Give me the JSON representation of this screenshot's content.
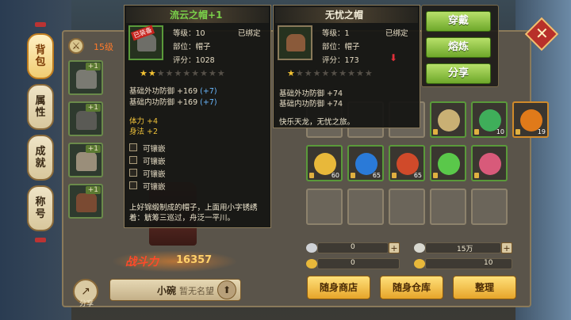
{
  "tabs": [
    "背包",
    "属性",
    "成就",
    "称号"
  ],
  "left_header": {
    "level": "15级"
  },
  "equip_slots": [
    {
      "plus": "+1",
      "icon": "helmet-icon"
    },
    {
      "plus": "+1",
      "icon": "armor-icon"
    },
    {
      "plus": "+1",
      "icon": "shoulder-icon"
    },
    {
      "plus": "+1",
      "icon": "boots-icon"
    }
  ],
  "character": {
    "power_label": "战斗力",
    "power_value": "16357",
    "name": "小碗",
    "title": "暂无名望",
    "share_label": "分享"
  },
  "tooltip_current": {
    "title": "流云之帽",
    "title_plus": "+1",
    "badge": "已装备",
    "level": "等级：10",
    "bound": "已绑定",
    "part": "部位：帽子",
    "score": "评分：1028",
    "stars_on": 2,
    "stars_total": 10,
    "stat1": "基础外功防御 +169",
    "stat1_bonus": "(+7)",
    "stat2": "基础内功防御 +169",
    "stat2_bonus": "(+7)",
    "attr1": "体力 +4",
    "attr2": "身法 +2",
    "sockets": [
      "可镶嵌",
      "可镶嵌",
      "可镶嵌",
      "可镶嵌"
    ],
    "desc": "上好锦缎制成的帽子，上面用小字锈绣着：觥筹三巡过，舟泛一平川。"
  },
  "tooltip_compare": {
    "title": "无忧之帽",
    "level": "等级：1",
    "bound": "已绑定",
    "part": "部位：帽子",
    "score": "评分：173",
    "stars_on": 1,
    "stars_total": 10,
    "stat1": "基础外功防御 +74",
    "stat2": "基础内功防御 +74",
    "desc": "快乐天龙，无忧之旅。"
  },
  "actions": [
    "穿戴",
    "熔炼",
    "分享"
  ],
  "inventory": [
    {
      "row": 0,
      "col": 0,
      "type": "empty"
    },
    {
      "row": 0,
      "col": 1,
      "type": "empty"
    },
    {
      "row": 0,
      "col": 2,
      "type": "empty"
    },
    {
      "row": 0,
      "col": 3,
      "type": "green",
      "item": "bracelet-icon",
      "count": ""
    },
    {
      "row": 0,
      "col": 4,
      "type": "green",
      "item": "necklace-icon",
      "count": "10"
    },
    {
      "row": 0,
      "col": 5,
      "type": "orange",
      "item": "scroll-icon",
      "count": "19"
    },
    {
      "row": 1,
      "col": 0,
      "type": "green",
      "item": "gold-ingot-icon",
      "count": "60"
    },
    {
      "row": 1,
      "col": 1,
      "type": "green",
      "item": "blue-sand-icon",
      "count": "65"
    },
    {
      "row": 1,
      "col": 2,
      "type": "green",
      "item": "red-sand-icon",
      "count": "65"
    },
    {
      "row": 1,
      "col": 3,
      "type": "green",
      "item": "jade-icon",
      "count": ""
    },
    {
      "row": 1,
      "col": 4,
      "type": "green",
      "item": "gem-icon",
      "count": ""
    },
    {
      "row": 2,
      "col": 0,
      "type": "empty"
    },
    {
      "row": 2,
      "col": 1,
      "type": "empty"
    },
    {
      "row": 2,
      "col": 2,
      "type": "empty"
    },
    {
      "row": 2,
      "col": 3,
      "type": "empty"
    },
    {
      "row": 2,
      "col": 4,
      "type": "empty"
    }
  ],
  "currency": {
    "silver": "0",
    "gold": "15万",
    "ingot": "0",
    "bound_ingot": "10"
  },
  "bottom_buttons": [
    "随身商店",
    "随身仓库",
    "整理"
  ]
}
